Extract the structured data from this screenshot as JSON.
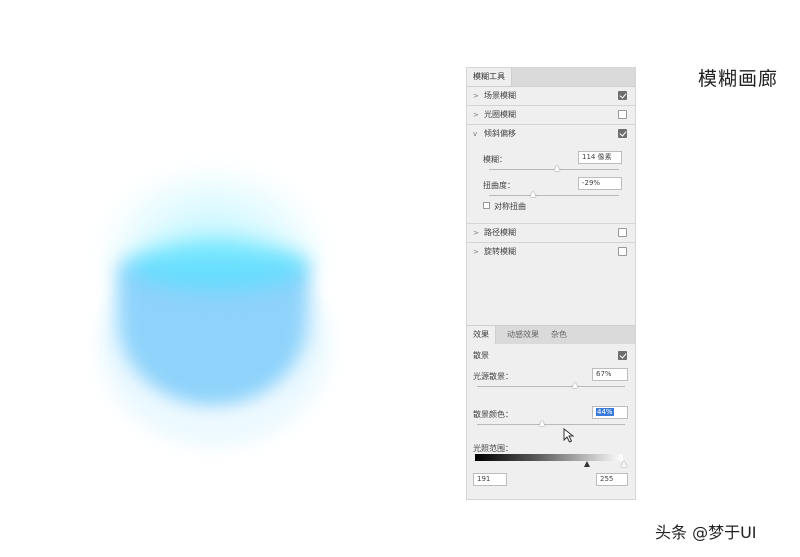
{
  "gallery_title": "模糊画廊",
  "panel": {
    "tab_label": "模糊工具",
    "blur_items": [
      {
        "label": "场景模糊",
        "checked": true,
        "expanded": false
      },
      {
        "label": "光圈模糊",
        "checked": false,
        "expanded": false
      },
      {
        "label": "倾斜偏移",
        "checked": true,
        "expanded": true
      }
    ],
    "tilt_shift": {
      "blur_label": "模糊：",
      "blur_value": "114 像素",
      "distortion_label": "扭曲度：",
      "distortion_value": "-29%",
      "symmetric_label": "对称扭曲",
      "symmetric_checked": false
    },
    "more_items": [
      {
        "label": "路径模糊",
        "checked": false
      },
      {
        "label": "旋转模糊",
        "checked": false
      }
    ],
    "effects_tabs": [
      "效果",
      "动感效果",
      "杂色"
    ],
    "bokeh": {
      "label": "散景",
      "checked": true,
      "light_bokeh_label": "光源散景：",
      "light_bokeh_value": "67%",
      "bokeh_color_label": "散景颜色：",
      "bokeh_color_value": "44%",
      "light_range_label": "光照范围：",
      "range_min": "191",
      "range_max": "255"
    }
  },
  "watermark": "头条 @梦于UI",
  "colors": {
    "accent": "#3b7bd9",
    "blob_blue": "#8fd3fb",
    "blob_cyan": "#50e1ff"
  }
}
